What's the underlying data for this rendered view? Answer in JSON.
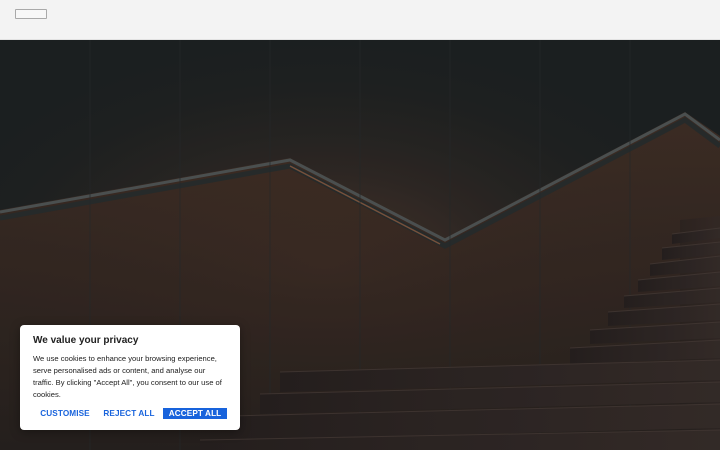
{
  "header": {
    "logo_icon": "broken-image-icon"
  },
  "cookie_banner": {
    "title": "We value your privacy",
    "body": "We use cookies to enhance your browsing experience, serve personalised ads or content, and analyse our traffic. By clicking \"Accept All\", you consent to our use of cookies.",
    "customise_label": "CUSTOMISE",
    "reject_label": "REJECT ALL",
    "accept_label": "ACCEPT ALL",
    "accent_color": "#1863dc"
  }
}
